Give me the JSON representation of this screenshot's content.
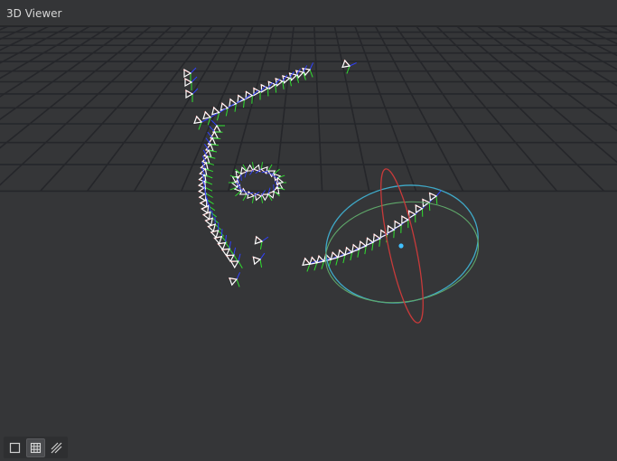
{
  "window": {
    "title": "3D Viewer"
  },
  "toolbar": {
    "buttons": [
      {
        "icon": "square-outline-icon",
        "active": false
      },
      {
        "icon": "grid-icon",
        "active": true
      },
      {
        "icon": "diagonal-hatch-icon",
        "active": false
      }
    ]
  },
  "colors": {
    "background": "#353638",
    "grid": "#25262a",
    "camera": "#ffffff",
    "axis_x": "#ff3030",
    "axis_y": "#30e030",
    "axis_z": "#3040ff",
    "gizmo_red": "#c83a3a",
    "gizmo_green": "#5fa86a",
    "gizmo_cyan": "#3fa9c8",
    "gizmo_center": "#40c0ff"
  }
}
